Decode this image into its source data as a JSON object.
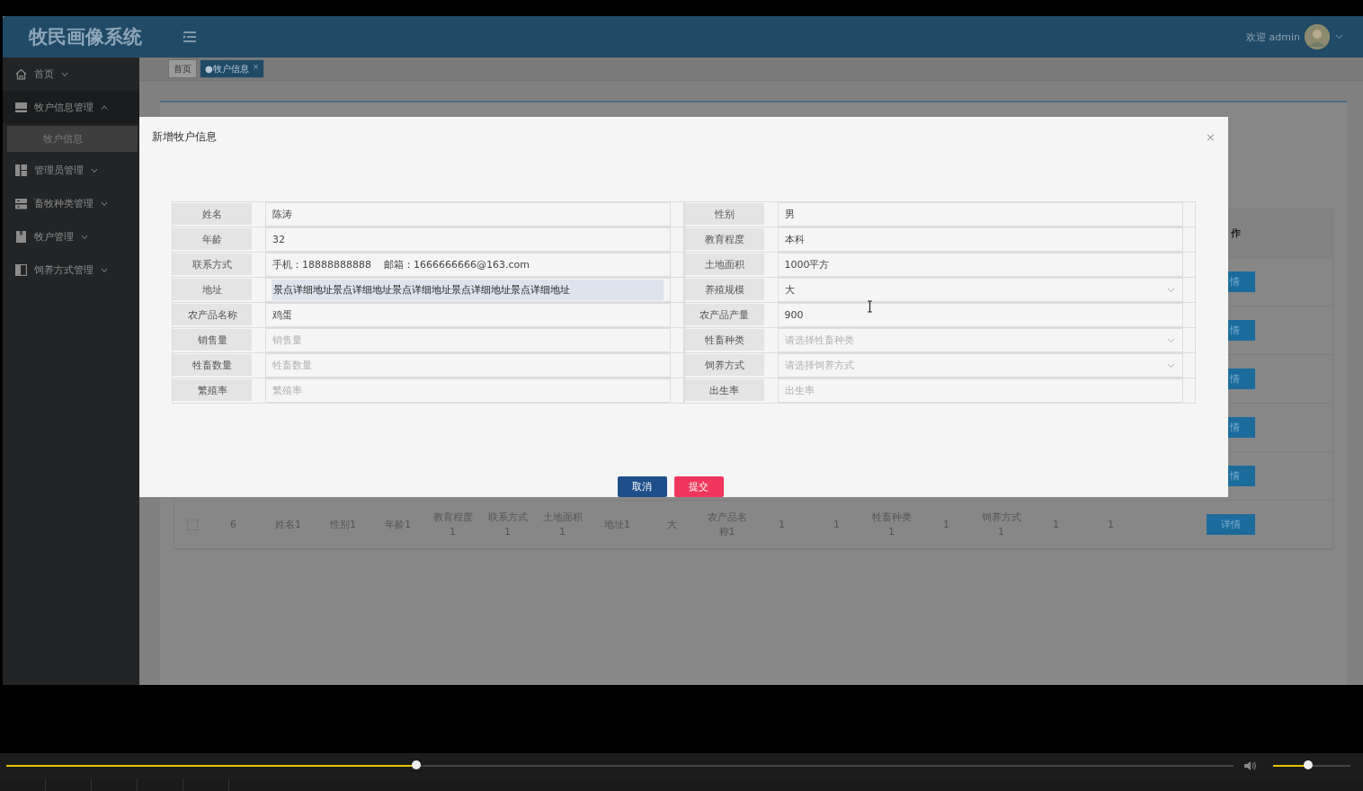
{
  "header": {
    "title": "牧民画像系统",
    "greeting": "欢迎 admin"
  },
  "sidebar": {
    "items": [
      {
        "label": "首页",
        "expanded": false
      },
      {
        "label": "牧户信息管理",
        "expanded": true,
        "children": [
          {
            "label": "牧户信息",
            "selected": true
          }
        ]
      },
      {
        "label": "管理员管理",
        "expanded": false
      },
      {
        "label": "畜牧种类管理",
        "expanded": false
      },
      {
        "label": "牧户管理",
        "expanded": false
      },
      {
        "label": "饲养方式管理",
        "expanded": false
      }
    ]
  },
  "tabs": [
    {
      "label": "首页",
      "selected": false
    },
    {
      "label": "●牧户信息",
      "selected": true,
      "close": "×"
    }
  ],
  "table": {
    "action_column": "作",
    "rows": [
      {
        "action": "情"
      },
      {
        "action": "情"
      },
      {
        "action": "情"
      },
      {
        "action": "情"
      },
      {
        "action": "情"
      },
      {
        "checked": false,
        "cells": [
          "6",
          "姓名1",
          "性别1",
          "年龄1",
          "教育程度1",
          "联系方式1",
          "土地面积1",
          "地址1",
          "大",
          "农产品名称1",
          "1",
          "1",
          "牲畜种类1",
          "1",
          "饲养方式1",
          "1",
          "1"
        ],
        "action": "详情"
      }
    ]
  },
  "modal": {
    "title": "新增牧户信息",
    "close": "×",
    "fields": [
      {
        "label": "姓名",
        "kind": "text",
        "value": "陈涛"
      },
      {
        "label": "性别",
        "kind": "text",
        "value": "男"
      },
      {
        "label": "年龄",
        "kind": "text",
        "value": "32"
      },
      {
        "label": "教育程度",
        "kind": "text",
        "value": "本科"
      },
      {
        "label": "联系方式",
        "kind": "text",
        "value": "手机：18888888888    邮箱：1666666666@163.com"
      },
      {
        "label": "土地面积",
        "kind": "text",
        "value": "1000平方"
      },
      {
        "label": "地址",
        "kind": "text",
        "value": "景点详细地址景点详细地址景点详细地址景点详细地址景点详细地址",
        "highlighted": true
      },
      {
        "label": "养殖规模",
        "kind": "select",
        "value": "大"
      },
      {
        "label": "农产品名称",
        "kind": "text",
        "value": "鸡蛋"
      },
      {
        "label": "农产品产量",
        "kind": "text",
        "value": "900"
      },
      {
        "label": "销售量",
        "kind": "text",
        "placeholder": "销售量"
      },
      {
        "label": "牲畜种类",
        "kind": "select",
        "placeholder": "请选择牲畜种类"
      },
      {
        "label": "牲畜数量",
        "kind": "text",
        "placeholder": "牲畜数量"
      },
      {
        "label": "饲养方式",
        "kind": "select",
        "placeholder": "请选择饲养方式"
      },
      {
        "label": "繁殖率",
        "kind": "text",
        "placeholder": "繁殖率"
      },
      {
        "label": "出生率",
        "kind": "text",
        "placeholder": "出生率"
      }
    ],
    "buttons": [
      {
        "label": "取消",
        "kind": "primary"
      },
      {
        "label": "提交",
        "kind": "danger"
      }
    ]
  },
  "player": {
    "progress": {
      "level": 0.334
    },
    "volume": {
      "level": 0.45
    }
  }
}
